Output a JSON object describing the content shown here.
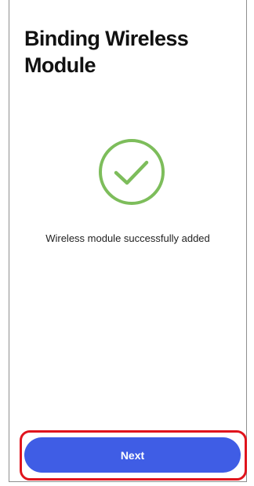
{
  "header": {
    "title": "Binding Wireless Module"
  },
  "status": {
    "icon": "check-circle-icon",
    "message": "Wireless module successfully added",
    "color": "#7dbd5b"
  },
  "footer": {
    "next_label": "Next",
    "button_color": "#3f5de5",
    "highlight_color": "#e0141d"
  }
}
